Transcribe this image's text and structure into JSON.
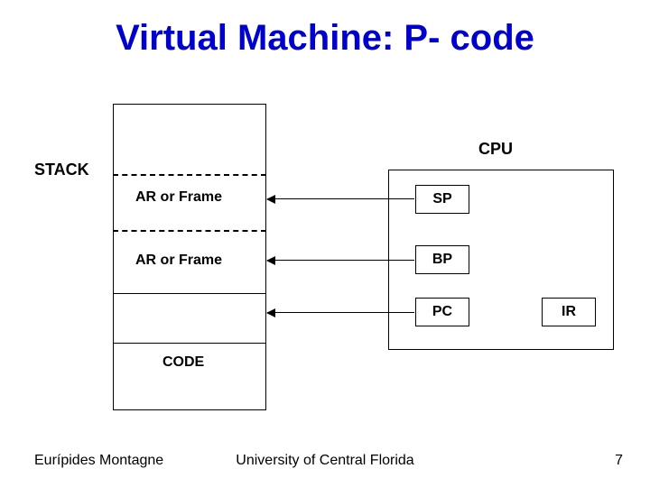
{
  "title": "Virtual Machine: P- code",
  "labels": {
    "stack": "STACK",
    "ar1": "AR or Frame",
    "ar2": "AR or Frame",
    "code": "CODE",
    "cpu": "CPU",
    "sp": "SP",
    "bp": "BP",
    "pc": "PC",
    "ir": "IR"
  },
  "footer": {
    "author": "Eurípides Montagne",
    "org": "University of Central Florida",
    "page": "7"
  }
}
